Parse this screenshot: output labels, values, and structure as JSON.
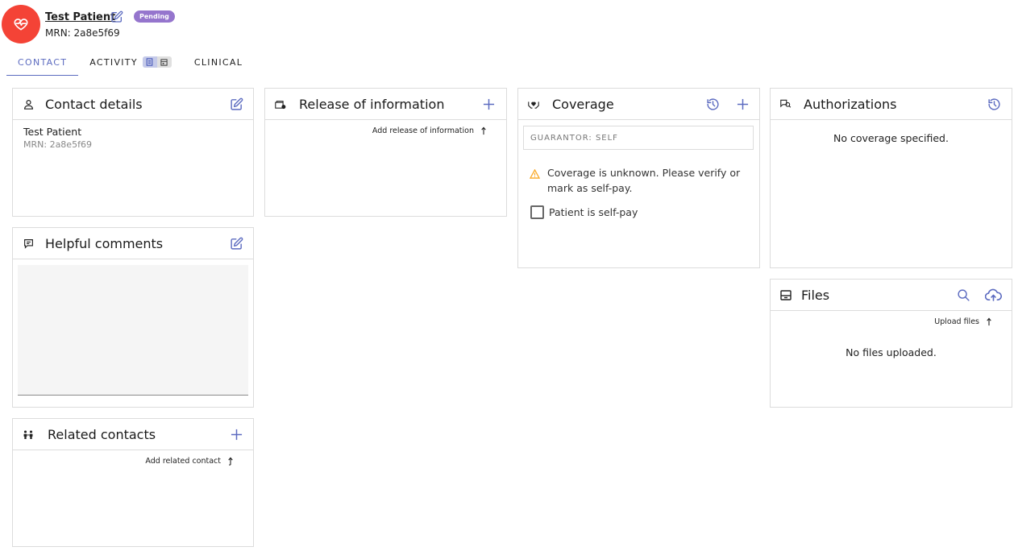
{
  "patient": {
    "name": "Test Patient",
    "status": "Pending",
    "mrn_label": "MRN: 2a8e5f69"
  },
  "tabs": [
    {
      "label": "CONTACT",
      "active": true
    },
    {
      "label": "ACTIVITY",
      "active": false
    },
    {
      "label": "CLINICAL",
      "active": false
    }
  ],
  "cards": {
    "contact_details": {
      "title": "Contact details",
      "name": "Test Patient",
      "mrn": "MRN: 2a8e5f69"
    },
    "helpful_comments": {
      "title": "Helpful comments",
      "value": ""
    },
    "related_contacts": {
      "title": "Related contacts",
      "add_label": "Add related contact"
    },
    "release_of_information": {
      "title": "Release of information",
      "add_label": "Add release of information"
    },
    "coverage": {
      "title": "Coverage",
      "guarantor": "GUARANTOR: SELF",
      "warning": "Coverage is unknown. Please verify or mark as self-pay.",
      "self_pay_label": "Patient is self-pay",
      "self_pay_checked": false
    },
    "authorizations": {
      "title": "Authorizations",
      "empty": "No coverage specified."
    },
    "files": {
      "title": "Files",
      "upload_label": "Upload files",
      "empty": "No files uploaded."
    }
  },
  "colors": {
    "accent": "#5c6bc0",
    "avatar": "#f44336",
    "badge": "#9575cd",
    "warning": "#f9a825"
  },
  "icons": {
    "avatar": "heart-pulse-icon",
    "edit": "edit-icon",
    "add": "plus-icon",
    "history": "history-icon",
    "search": "search-icon",
    "upload": "cloud-upload-icon",
    "arrow": "arrow-up-icon",
    "warning": "warning-icon"
  }
}
